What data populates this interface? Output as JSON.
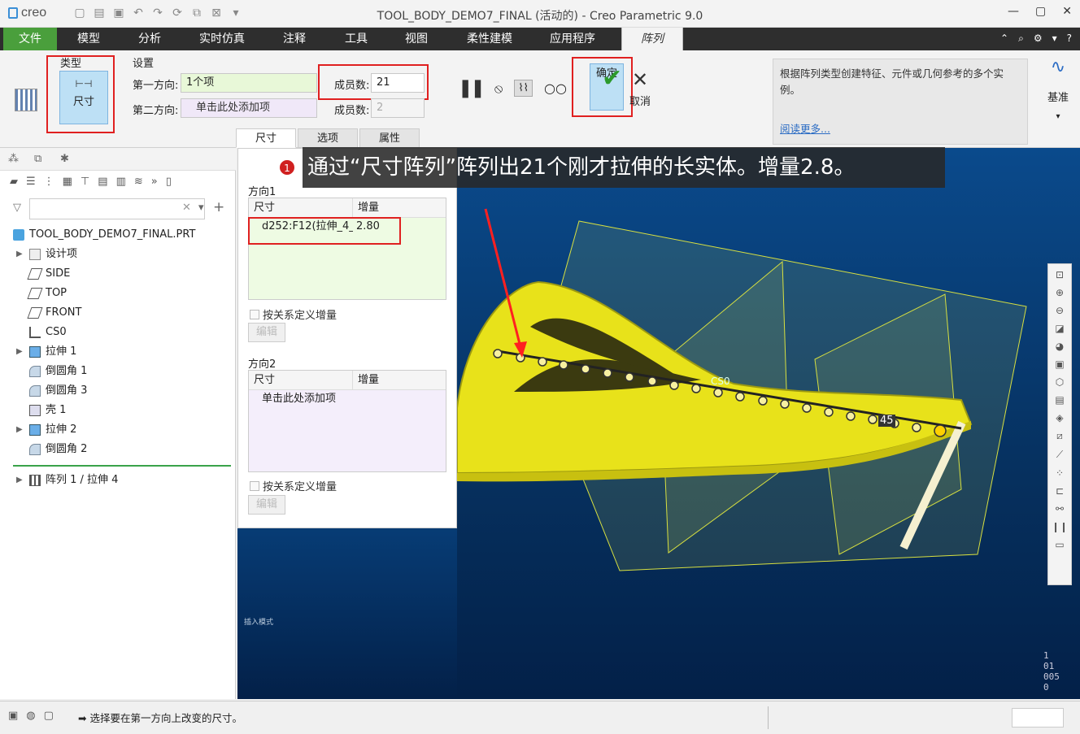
{
  "app": {
    "logo": "creo",
    "window_title": "TOOL_BODY_DEMO7_FINAL (活动的) - Creo Parametric 9.0"
  },
  "menu": {
    "items": [
      "文件",
      "模型",
      "分析",
      "实时仿真",
      "注释",
      "工具",
      "视图",
      "柔性建模",
      "应用程序",
      "阵列"
    ]
  },
  "ribbon": {
    "type_label": "类型",
    "type_button": "尺寸",
    "settings_label": "设置",
    "dir1_label": "第一方向:",
    "dir1_value": "1个项",
    "dir2_label": "第二方向:",
    "dir2_placeholder": "单击此处添加项",
    "members1_label": "成员数:",
    "members1_value": "21",
    "members2_label": "成员数:",
    "members2_value": "2",
    "ok_label": "确定",
    "cancel_label": "取消",
    "tabs": [
      "尺寸",
      "选项",
      "属性"
    ],
    "help_text": "根据阵列类型创建特征、元件或几何参考的多个实例。",
    "help_link": "阅读更多...",
    "datum_label": "基准"
  },
  "tree": {
    "root": "TOOL_BODY_DEMO7_FINAL.PRT",
    "items": [
      "设计项",
      "SIDE",
      "TOP",
      "FRONT",
      "CS0",
      "拉伸 1",
      "倒圆角 1",
      "倒圆角 3",
      "壳 1",
      "拉伸 2",
      "倒圆角 2"
    ],
    "pattern_item": "阵列 1 / 拉伸 4"
  },
  "dashboard": {
    "dir1_title": "方向1",
    "dir2_title": "方向2",
    "col_dim": "尺寸",
    "col_inc": "增量",
    "row_dim": "d252:F12(拉伸_4_",
    "row_inc": "2.80",
    "dir2_placeholder": "单击此处添加项",
    "relation_label": "按关系定义增量",
    "edit_label": "编辑"
  },
  "annotation": {
    "badge": "1",
    "text": "通过“尺寸阵列”阵列出21个刚才拉伸的长实体。增量2.8。"
  },
  "viewport": {
    "cs_label": "CS0",
    "dim_label": "45",
    "mode_label": "插入模式",
    "coord_lines": [
      "1",
      "01",
      "005",
      "0"
    ]
  },
  "status": {
    "message": "选择要在第一方向上改变的尺寸。"
  }
}
